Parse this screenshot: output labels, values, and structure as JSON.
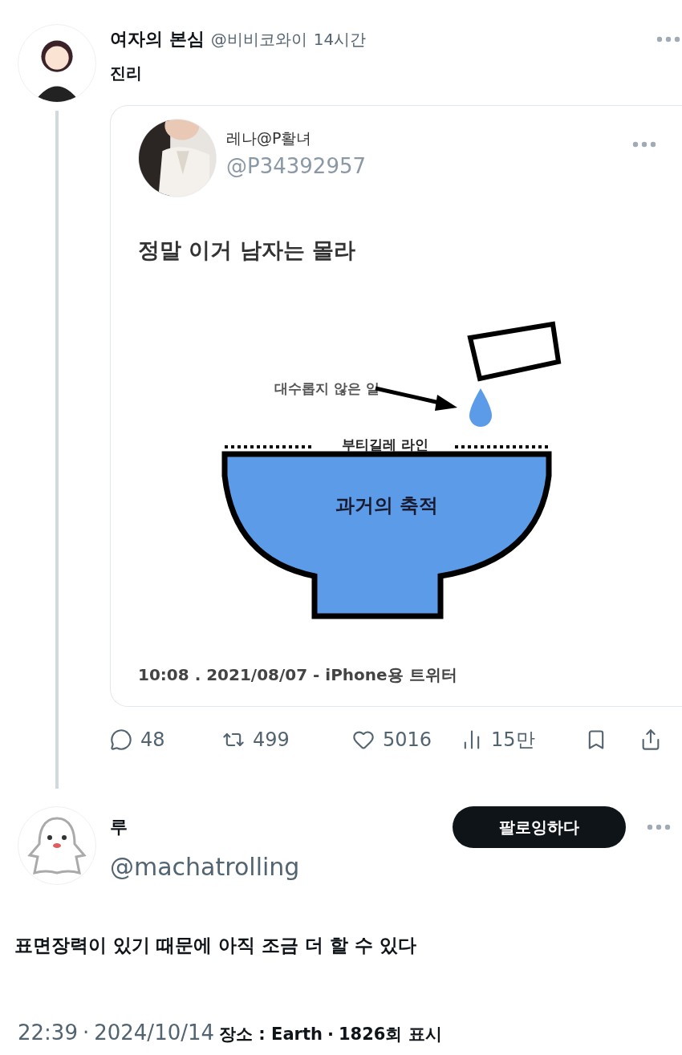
{
  "tweet": {
    "name": "여자의 본심",
    "handle": "@비비코와이",
    "time": "14시간",
    "text": "진리",
    "quote": {
      "name": "레나@P활녀",
      "handle": "@P34392957",
      "text": "정말 이거 남자는 몰라",
      "diagram": {
        "drop_label": "대수롭지 않은 일",
        "line_label": "부티길레 라인",
        "bowl_label": "과거의 축적"
      },
      "timestamp": "10:08 . 2021/08/07 - iPhone용 트위터"
    },
    "actions": [
      {
        "kind": "reply",
        "count": "48"
      },
      {
        "kind": "retweet",
        "count": "499"
      },
      {
        "kind": "like",
        "count": "5016"
      },
      {
        "kind": "views",
        "count": "15만"
      },
      {
        "kind": "bookmark"
      },
      {
        "kind": "share"
      }
    ]
  },
  "reply": {
    "name": "루",
    "handle": "@machatrolling",
    "follow_label": "팔로잉하다",
    "text": "표면장력이 있기 때문에 아직 조금 더 할 수 있다",
    "time": "22:39",
    "separator_1": "·",
    "date": "2024/10/14",
    "place": "장소 : Earth",
    "separator_2": "·",
    "views": "1826회 표시"
  }
}
